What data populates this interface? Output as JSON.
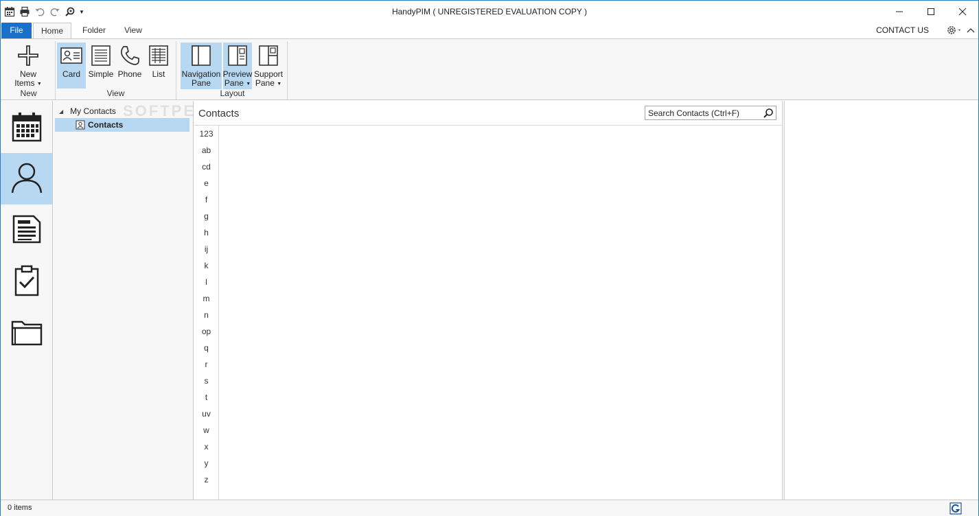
{
  "window": {
    "title": "HandyPIM ( UNREGISTERED EVALUATION COPY )",
    "watermark": "SOFTPEDIA"
  },
  "quick_access": [
    "calendar-icon",
    "print-icon",
    "undo-icon",
    "redo-icon",
    "find-icon",
    "customize-dropdown"
  ],
  "tabs": {
    "file": "File",
    "home": "Home",
    "folder": "Folder",
    "view": "View"
  },
  "header_right": {
    "contact_us": "CONTACT US"
  },
  "ribbon": {
    "groups": {
      "new": {
        "label": "New",
        "new_items": {
          "line1": "New",
          "line2": "Items"
        }
      },
      "view": {
        "label": "View",
        "card": "Card",
        "simple": "Simple",
        "phone": "Phone",
        "list": "List"
      },
      "layout": {
        "label": "Layout",
        "navigation_pane": {
          "line1": "Navigation",
          "line2": "Pane"
        },
        "preview_pane": {
          "line1": "Preview",
          "line2": "Pane"
        },
        "support_pane": {
          "line1": "Support",
          "line2": "Pane"
        }
      }
    }
  },
  "nav": {
    "items": [
      "calendar",
      "contacts",
      "notes",
      "tasks",
      "folders"
    ],
    "selected": "contacts"
  },
  "tree": {
    "root": "My Contacts",
    "child": "Contacts"
  },
  "main": {
    "title": "Contacts",
    "search_placeholder": "Search Contacts (Ctrl+F)",
    "alphabet": [
      "123",
      "ab",
      "cd",
      "e",
      "f",
      "g",
      "h",
      "ij",
      "k",
      "l",
      "m",
      "n",
      "op",
      "q",
      "r",
      "s",
      "t",
      "uv",
      "w",
      "x",
      "y",
      "z"
    ]
  },
  "status": {
    "items_text": "0 items"
  },
  "colors": {
    "accent": "#1a6fc9",
    "selection": "#b8d8f2"
  }
}
